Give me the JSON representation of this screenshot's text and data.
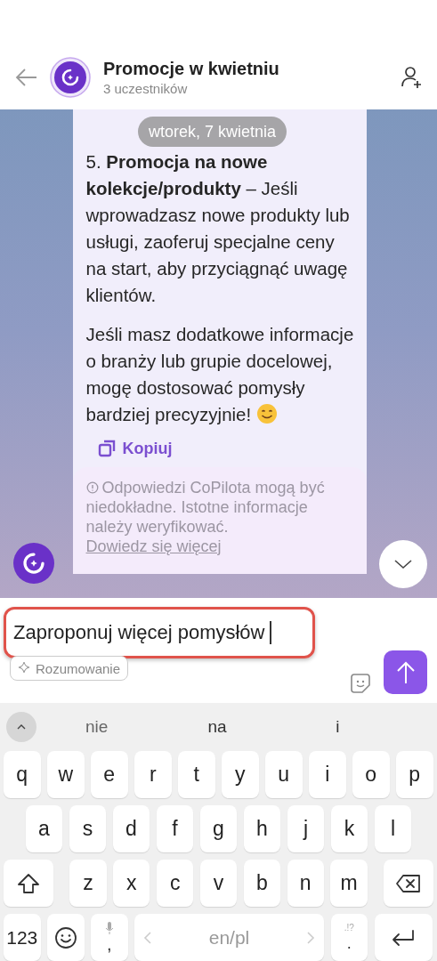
{
  "header": {
    "title": "Promocje w kwietniu",
    "subtitle": "3 uczestników"
  },
  "date_separator": "wtorek, 7 kwietnia",
  "message": {
    "paragraphs": [
      "5. **Promocja na nowe kolekcje/produkty** – Jeśli wprowadzasz nowe produkty lub usługi, zaoferuj specjalne ceny na start, aby przyciągnąć uwagę klientów.",
      "Jeśli masz dodatkowe informacje o branży lub grupie docelowej, mogę dostosować pomysły bardziej precyzyjnie!"
    ],
    "copy_label": "Kopiuj",
    "disclaimer": {
      "text": "Odpowiedzi CoPilota mogą być niedokładne. Istotne informacje należy weryfikować.",
      "link": "Dowiedz się więcej"
    }
  },
  "composer": {
    "value": "Zaproponuj więcej pomysłów",
    "chip": "Rozumowanie"
  },
  "keyboard": {
    "suggestions": [
      "nie",
      "na",
      "i"
    ],
    "rows": [
      {
        "keys": [
          {
            "kind": "char",
            "label": "q"
          },
          {
            "kind": "char",
            "label": "w"
          },
          {
            "kind": "char",
            "label": "e"
          },
          {
            "kind": "char",
            "label": "r"
          },
          {
            "kind": "char",
            "label": "t"
          },
          {
            "kind": "char",
            "label": "y"
          },
          {
            "kind": "char",
            "label": "u"
          },
          {
            "kind": "char",
            "label": "i"
          },
          {
            "kind": "char",
            "label": "o"
          },
          {
            "kind": "char",
            "label": "p"
          }
        ]
      },
      {
        "keys": [
          {
            "kind": "char",
            "label": "a"
          },
          {
            "kind": "char",
            "label": "s"
          },
          {
            "kind": "char",
            "label": "d"
          },
          {
            "kind": "char",
            "label": "f"
          },
          {
            "kind": "char",
            "label": "g"
          },
          {
            "kind": "char",
            "label": "h"
          },
          {
            "kind": "char",
            "label": "j"
          },
          {
            "kind": "char",
            "label": "k"
          },
          {
            "kind": "char",
            "label": "l"
          }
        ]
      },
      {
        "keys": [
          {
            "kind": "shift"
          },
          {
            "kind": "char",
            "label": "z"
          },
          {
            "kind": "char",
            "label": "x"
          },
          {
            "kind": "char",
            "label": "c"
          },
          {
            "kind": "char",
            "label": "v"
          },
          {
            "kind": "char",
            "label": "b"
          },
          {
            "kind": "char",
            "label": "n"
          },
          {
            "kind": "char",
            "label": "m"
          },
          {
            "kind": "backspace"
          }
        ]
      },
      {
        "keys": [
          {
            "kind": "symbols",
            "label": "123"
          },
          {
            "kind": "emoji"
          },
          {
            "kind": "comma",
            "label": ","
          },
          {
            "kind": "space",
            "label": "en/pl"
          },
          {
            "kind": "period",
            "label": ".",
            "hint": ".!?"
          },
          {
            "kind": "enter"
          }
        ]
      }
    ]
  }
}
